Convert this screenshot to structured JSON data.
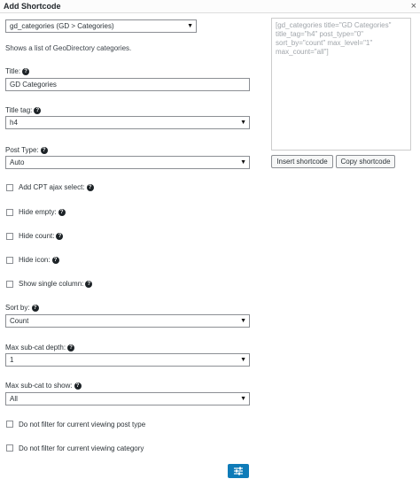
{
  "dialog": {
    "title": "Add Shortcode",
    "close_icon": "×"
  },
  "shortcode_select": {
    "value": "gd_categories (GD > Categories)"
  },
  "description": "Shows a list of GeoDirectory categories.",
  "fields": {
    "title": {
      "label": "Title:",
      "value": "GD Categories"
    },
    "title_tag": {
      "label": "Title tag:",
      "value": "h4"
    },
    "post_type": {
      "label": "Post Type:",
      "value": "Auto"
    },
    "add_cpt_ajax": {
      "label": "Add CPT ajax select:"
    },
    "hide_empty": {
      "label": "Hide empty:"
    },
    "hide_count": {
      "label": "Hide count:"
    },
    "hide_icon": {
      "label": "Hide icon:"
    },
    "show_single_column": {
      "label": "Show single column:"
    },
    "sort_by": {
      "label": "Sort by:",
      "value": "Count"
    },
    "max_sub_cat_depth": {
      "label": "Max sub-cat depth:",
      "value": "1"
    },
    "max_sub_cat_to_show": {
      "label": "Max sub-cat to show:",
      "value": "All"
    },
    "no_filter_post_type": {
      "label": "Do not filter for current viewing post type"
    },
    "no_filter_category": {
      "label": "Do not filter for current viewing category"
    }
  },
  "preview": {
    "text": "[gd_categories title=\"GD Categories\"\ntitle_tag=\"h4\" post_type=\"0\"\nsort_by=\"count\" max_level=\"1\"\nmax_count=\"all\"]"
  },
  "buttons": {
    "insert": "Insert shortcode",
    "copy": "Copy shortcode"
  },
  "icons": {
    "help": "?",
    "arrow": "▼",
    "settings": "sliders-icon"
  },
  "colors": {
    "accent": "#0e7bb8"
  }
}
